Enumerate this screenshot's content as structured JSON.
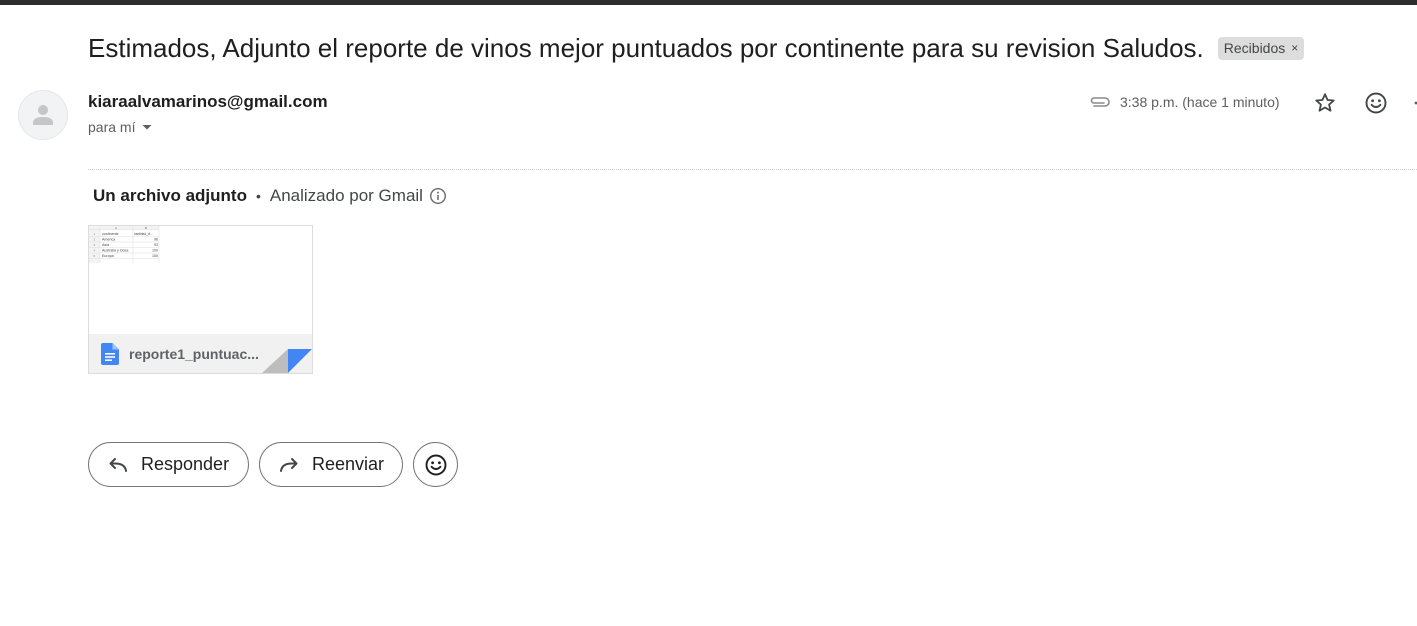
{
  "email": {
    "subject": "Estimados, Adjunto el reporte de vinos mejor puntuados por continente para su revision Saludos.",
    "label": "Recibidos",
    "label_close": "×",
    "sender": "kiaraalvamarinos@gmail.com",
    "recipient": "para mí",
    "time": "3:38 p.m. (hace 1 minuto)"
  },
  "attachments": {
    "count_label": "Un archivo adjunto",
    "separator": "•",
    "scanned_label": "Analizado por Gmail",
    "files": [
      {
        "name": "reporte1_puntuac...",
        "preview": {
          "columns": [
            "A",
            "B"
          ],
          "rows": [
            [
              "1",
              "continente",
              "cantidad_vi..."
            ],
            [
              "2",
              "América",
              "96"
            ],
            [
              "3",
              "Asia",
              "93"
            ],
            [
              "4",
              "Australia y Ocea",
              "100"
            ],
            [
              "5",
              "Europa",
              "100"
            ]
          ]
        }
      }
    ]
  },
  "actions": {
    "reply_label": "Responder",
    "forward_label": "Reenviar"
  },
  "icons": {
    "avatar": "person-icon",
    "recipient_dropdown": "caret-down-icon",
    "attachment": "paperclip-icon",
    "star": "star-icon",
    "emoji": "emoji-icon",
    "more": "more-vert-icon",
    "info": "info-icon",
    "file": "google-docs-icon",
    "reply": "reply-icon",
    "forward": "forward-icon"
  },
  "colors": {
    "file_icon": "#4285f4",
    "label_chip": "#dddddd"
  }
}
